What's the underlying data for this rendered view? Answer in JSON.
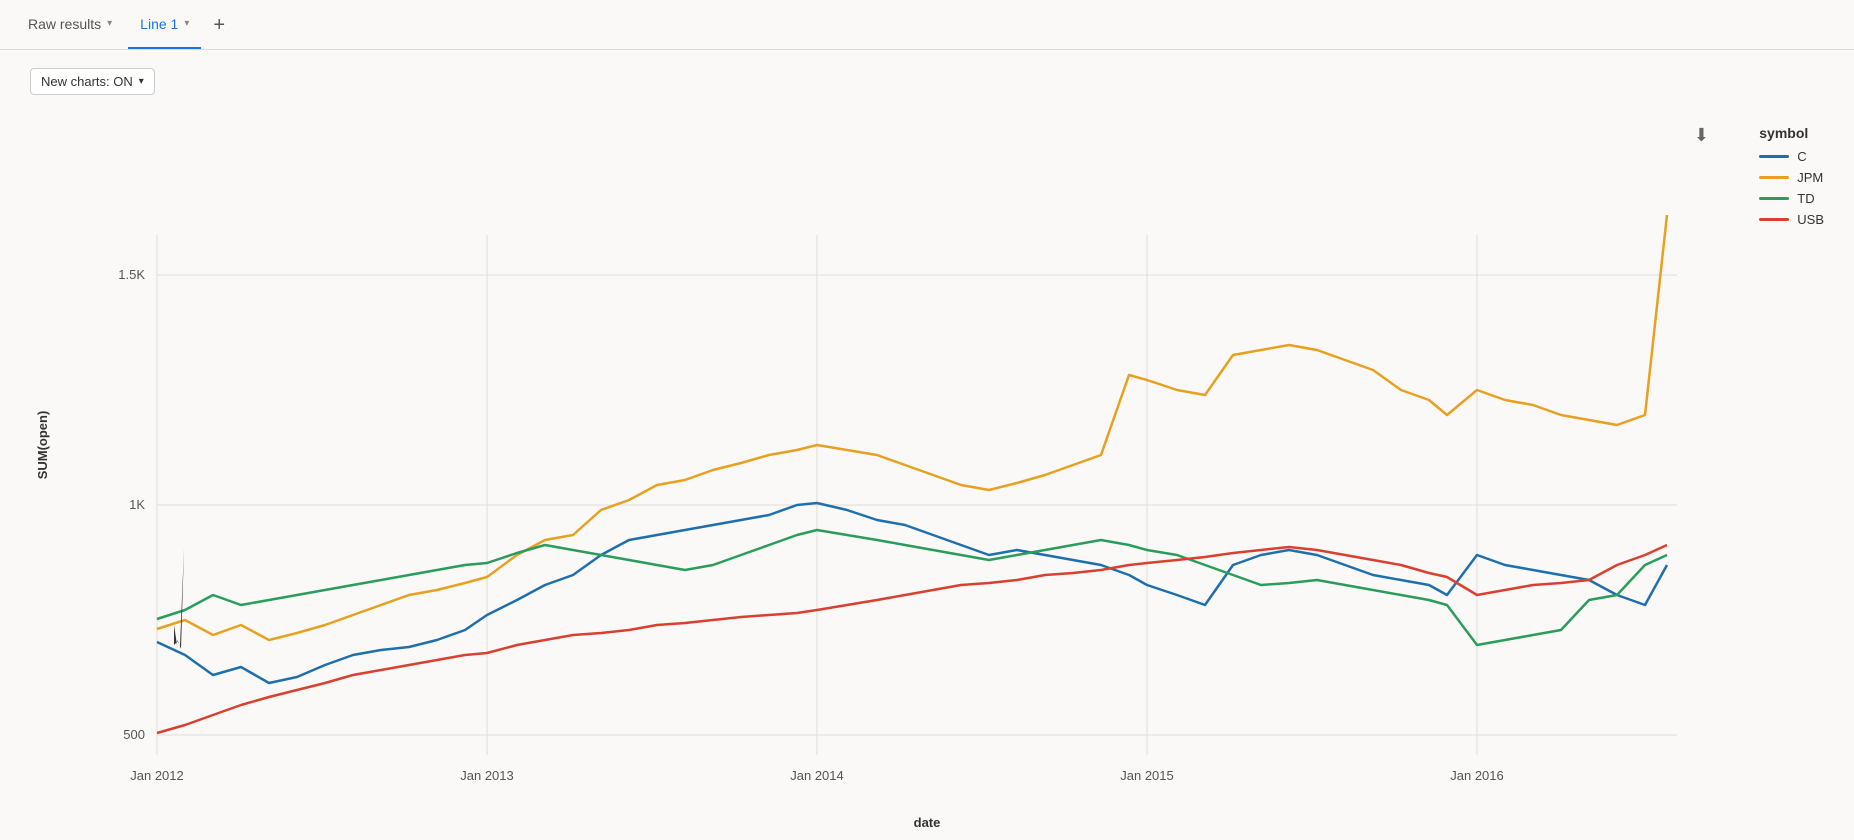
{
  "tabs": [
    {
      "id": "raw-results",
      "label": "Raw results",
      "active": false,
      "hasChevron": true
    },
    {
      "id": "line-1",
      "label": "Line 1",
      "active": true,
      "hasChevron": true
    }
  ],
  "tab_add_label": "+",
  "controls": {
    "new_charts_label": "New charts: ON",
    "chevron": "▾"
  },
  "legend": {
    "title": "symbol",
    "items": [
      {
        "id": "C",
        "label": "C",
        "color": "#1f6fad"
      },
      {
        "id": "JPM",
        "label": "JPM",
        "color": "#e8a020"
      },
      {
        "id": "TD",
        "label": "TD",
        "color": "#2a9d5c"
      },
      {
        "id": "USB",
        "label": "USB",
        "color": "#d94030"
      }
    ]
  },
  "chart": {
    "y_axis_label": "SUM(open)",
    "x_axis_label": "date",
    "y_ticks": [
      "500",
      "1K",
      "1.5K"
    ],
    "x_ticks": [
      "Jan 2012",
      "Jan 2013",
      "Jan 2014",
      "Jan 2015",
      "Jan 2016"
    ]
  },
  "download_icon_label": "⬇"
}
